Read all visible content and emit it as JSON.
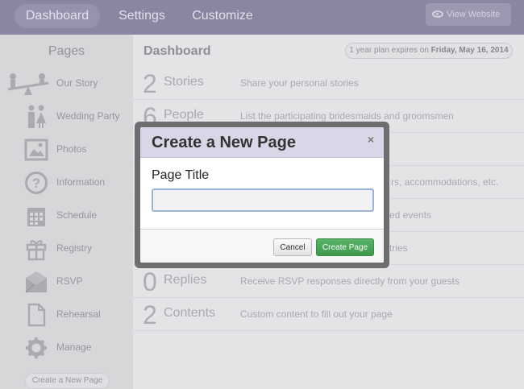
{
  "nav": {
    "tabs": [
      "Dashboard",
      "Settings",
      "Customize"
    ],
    "view_website": "View Website"
  },
  "sidebar": {
    "title": "Pages",
    "items": [
      {
        "label": "Our Story",
        "icon": "seesaw-icon"
      },
      {
        "label": "Wedding Party",
        "icon": "couple-icon"
      },
      {
        "label": "Photos",
        "icon": "photo-icon"
      },
      {
        "label": "Information",
        "icon": "question-icon"
      },
      {
        "label": "Schedule",
        "icon": "calendar-icon"
      },
      {
        "label": "Registry",
        "icon": "gift-icon"
      },
      {
        "label": "RSVP",
        "icon": "envelope-icon"
      },
      {
        "label": "Rehearsal",
        "icon": "document-icon"
      },
      {
        "label": "Manage",
        "icon": "gear-icon"
      }
    ],
    "new_page_button": "Create a New Page"
  },
  "main": {
    "title": "Dashboard",
    "plan": {
      "prefix": "1 year plan expires on ",
      "date": "Friday, May 16, 2014"
    },
    "rows": [
      {
        "count": "2",
        "name": "Stories",
        "desc": "Share your personal stories"
      },
      {
        "count": "6",
        "name": "People",
        "desc": "List the participating bridesmaids and groomsmen"
      },
      {
        "count": "",
        "name": "",
        "desc": ""
      },
      {
        "count": "",
        "name": "",
        "desc": "rs, accommodations, etc."
      },
      {
        "count": "",
        "name": "",
        "desc": "ed events"
      },
      {
        "count": "",
        "name": "",
        "desc": "tries"
      },
      {
        "count": "0",
        "name": "Replies",
        "desc": "Receive RSVP responses directly from your guests"
      },
      {
        "count": "2",
        "name": "Contents",
        "desc": "Custom content to fill out your page"
      }
    ]
  },
  "modal": {
    "title": "Create a New Page",
    "close": "×",
    "field_label": "Page Title",
    "field_value": "",
    "cancel": "Cancel",
    "create": "Create Page"
  },
  "colors": {
    "nav_bg": "#7f7a98",
    "modal_header": "#d9d6e7",
    "create_button": "#4aa758"
  }
}
